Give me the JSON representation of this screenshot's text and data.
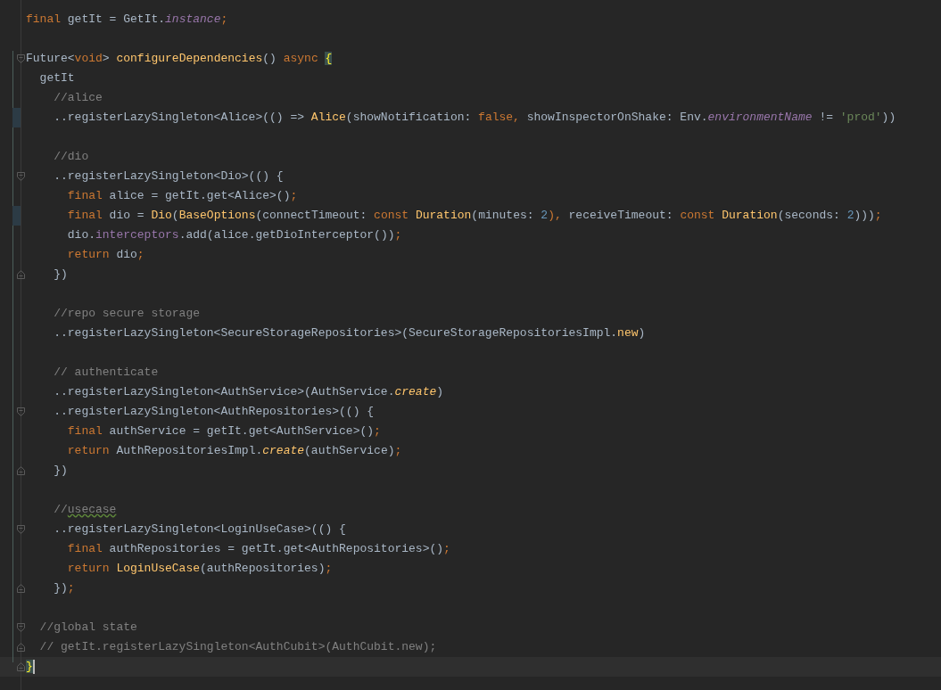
{
  "editor": {
    "lines": [
      {
        "kind": "code",
        "tokens": [
          {
            "text": "final",
            "kind": "keyword"
          },
          {
            "text": " getIt = GetIt.",
            "kind": "plain"
          },
          {
            "text": "instance",
            "kind": "field"
          },
          {
            "text": ";",
            "kind": "keyword"
          }
        ]
      },
      {
        "kind": "blank"
      },
      {
        "kind": "code",
        "fold_start": true,
        "tokens": [
          {
            "text": "Future<",
            "kind": "plain"
          },
          {
            "text": "void",
            "kind": "keyword"
          },
          {
            "text": "> ",
            "kind": "plain"
          },
          {
            "text": "configureDependencies",
            "kind": "function"
          },
          {
            "text": "() ",
            "kind": "plain"
          },
          {
            "text": "async ",
            "kind": "keyword"
          },
          {
            "text": "{",
            "kind": "brace_match"
          }
        ],
        "children": [
          {
            "kind": "code",
            "tokens": [
              {
                "text": "getIt",
                "kind": "plain"
              }
            ],
            "children": [
              {
                "kind": "code",
                "tokens": [
                  {
                    "text": "//alice",
                    "kind": "comment"
                  }
                ]
              },
              {
                "kind": "code",
                "changed": true,
                "tokens": [
                  {
                    "text": "..registerLazySingleton<Alice>(() => ",
                    "kind": "plain"
                  },
                  {
                    "text": "Alice",
                    "kind": "function"
                  },
                  {
                    "text": "(showNotification: ",
                    "kind": "plain"
                  },
                  {
                    "text": "false,",
                    "kind": "keyword"
                  },
                  {
                    "text": " showInspectorOnShake: Env.",
                    "kind": "plain"
                  },
                  {
                    "text": "environmentName",
                    "kind": "field"
                  },
                  {
                    "text": " != ",
                    "kind": "plain"
                  },
                  {
                    "text": "'prod'",
                    "kind": "string"
                  },
                  {
                    "text": "))",
                    "kind": "plain"
                  }
                ]
              },
              {
                "kind": "blank"
              },
              {
                "kind": "code",
                "tokens": [
                  {
                    "text": "//dio",
                    "kind": "comment"
                  }
                ]
              },
              {
                "kind": "code",
                "fold_start": true,
                "tokens": [
                  {
                    "text": "..registerLazySingleton<Dio>(() {",
                    "kind": "plain"
                  }
                ],
                "children": [
                  {
                    "kind": "code",
                    "tokens": [
                      {
                        "text": "final",
                        "kind": "keyword"
                      },
                      {
                        "text": " alice = getIt.get<Alice>()",
                        "kind": "plain"
                      },
                      {
                        "text": ";",
                        "kind": "keyword"
                      }
                    ]
                  },
                  {
                    "kind": "code",
                    "changed": true,
                    "tokens": [
                      {
                        "text": "final",
                        "kind": "keyword"
                      },
                      {
                        "text": " dio = ",
                        "kind": "plain"
                      },
                      {
                        "text": "Dio",
                        "kind": "function"
                      },
                      {
                        "text": "(",
                        "kind": "plain"
                      },
                      {
                        "text": "BaseOptions",
                        "kind": "function"
                      },
                      {
                        "text": "(connectTimeout: ",
                        "kind": "plain"
                      },
                      {
                        "text": "const ",
                        "kind": "keyword"
                      },
                      {
                        "text": "Duration",
                        "kind": "function"
                      },
                      {
                        "text": "(minutes: ",
                        "kind": "plain"
                      },
                      {
                        "text": "2",
                        "kind": "number"
                      },
                      {
                        "text": "),",
                        "kind": "keyword"
                      },
                      {
                        "text": " receiveTimeout: ",
                        "kind": "plain"
                      },
                      {
                        "text": "const ",
                        "kind": "keyword"
                      },
                      {
                        "text": "Duration",
                        "kind": "function"
                      },
                      {
                        "text": "(seconds: ",
                        "kind": "plain"
                      },
                      {
                        "text": "2",
                        "kind": "number"
                      },
                      {
                        "text": ")))",
                        "kind": "plain"
                      },
                      {
                        "text": ";",
                        "kind": "keyword"
                      }
                    ]
                  },
                  {
                    "kind": "code",
                    "tokens": [
                      {
                        "text": "dio.",
                        "kind": "plain"
                      },
                      {
                        "text": "interceptors",
                        "kind": "field_plain"
                      },
                      {
                        "text": ".add(alice.getDioInterceptor())",
                        "kind": "plain"
                      },
                      {
                        "text": ";",
                        "kind": "keyword"
                      }
                    ]
                  },
                  {
                    "kind": "code",
                    "tokens": [
                      {
                        "text": "return",
                        "kind": "keyword"
                      },
                      {
                        "text": " dio",
                        "kind": "plain"
                      },
                      {
                        "text": ";",
                        "kind": "keyword"
                      }
                    ]
                  }
                ]
              },
              {
                "kind": "code",
                "fold_end": true,
                "tokens": [
                  {
                    "text": "})",
                    "kind": "plain"
                  }
                ]
              },
              {
                "kind": "blank"
              },
              {
                "kind": "code",
                "tokens": [
                  {
                    "text": "//repo secure storage",
                    "kind": "comment"
                  }
                ]
              },
              {
                "kind": "code",
                "tokens": [
                  {
                    "text": "..registerLazySingleton<SecureStorageRepositories>(SecureStorageRepositoriesImpl.",
                    "kind": "plain"
                  },
                  {
                    "text": "new",
                    "kind": "function"
                  },
                  {
                    "text": ")",
                    "kind": "plain"
                  }
                ]
              },
              {
                "kind": "blank"
              },
              {
                "kind": "code",
                "tokens": [
                  {
                    "text": "// authenticate",
                    "kind": "comment"
                  }
                ]
              },
              {
                "kind": "code",
                "tokens": [
                  {
                    "text": "..registerLazySingleton<AuthService>(AuthService.",
                    "kind": "plain"
                  },
                  {
                    "text": "create",
                    "kind": "static"
                  },
                  {
                    "text": ")",
                    "kind": "plain"
                  }
                ]
              },
              {
                "kind": "code",
                "fold_start": true,
                "tokens": [
                  {
                    "text": "..registerLazySingleton<AuthRepositories>(() {",
                    "kind": "plain"
                  }
                ],
                "children": [
                  {
                    "kind": "code",
                    "tokens": [
                      {
                        "text": "final",
                        "kind": "keyword"
                      },
                      {
                        "text": " authService = getIt.get<AuthService>()",
                        "kind": "plain"
                      },
                      {
                        "text": ";",
                        "kind": "keyword"
                      }
                    ]
                  },
                  {
                    "kind": "code",
                    "tokens": [
                      {
                        "text": "return",
                        "kind": "keyword"
                      },
                      {
                        "text": " AuthRepositoriesImpl.",
                        "kind": "plain"
                      },
                      {
                        "text": "create",
                        "kind": "static"
                      },
                      {
                        "text": "(authService)",
                        "kind": "plain"
                      },
                      {
                        "text": ";",
                        "kind": "keyword"
                      }
                    ]
                  }
                ]
              },
              {
                "kind": "code",
                "fold_end": true,
                "tokens": [
                  {
                    "text": "})",
                    "kind": "plain"
                  }
                ]
              },
              {
                "kind": "blank"
              },
              {
                "kind": "code",
                "tokens": [
                  {
                    "text": "//",
                    "kind": "comment"
                  },
                  {
                    "text": "usecase",
                    "kind": "typo"
                  }
                ]
              },
              {
                "kind": "code",
                "fold_start": true,
                "tokens": [
                  {
                    "text": "..registerLazySingleton<LoginUseCase>(() {",
                    "kind": "plain"
                  }
                ],
                "children": [
                  {
                    "kind": "code",
                    "tokens": [
                      {
                        "text": "final",
                        "kind": "keyword"
                      },
                      {
                        "text": " authRepositories = getIt.get<AuthRepositories>()",
                        "kind": "plain"
                      },
                      {
                        "text": ";",
                        "kind": "keyword"
                      }
                    ]
                  },
                  {
                    "kind": "code",
                    "tokens": [
                      {
                        "text": "return ",
                        "kind": "keyword"
                      },
                      {
                        "text": "LoginUseCase",
                        "kind": "function"
                      },
                      {
                        "text": "(authRepositories)",
                        "kind": "plain"
                      },
                      {
                        "text": ";",
                        "kind": "keyword"
                      }
                    ]
                  }
                ]
              },
              {
                "kind": "code",
                "fold_end": true,
                "tokens": [
                  {
                    "text": "})",
                    "kind": "plain"
                  },
                  {
                    "text": ";",
                    "kind": "keyword"
                  }
                ]
              },
              {
                "kind": "blank"
              }
            ]
          },
          {
            "kind": "code",
            "fold_start": true,
            "tokens": [
              {
                "text": "//global state",
                "kind": "comment"
              }
            ]
          },
          {
            "kind": "code",
            "fold_end": true,
            "tokens": [
              {
                "text": "// getIt.registerLazySingleton<AuthCubit>(AuthCubit.new);",
                "kind": "comment"
              }
            ]
          }
        ]
      },
      {
        "kind": "code",
        "fold_end": true,
        "current": true,
        "tokens": [
          {
            "text": "}",
            "kind": "brace_match"
          }
        ]
      }
    ]
  }
}
